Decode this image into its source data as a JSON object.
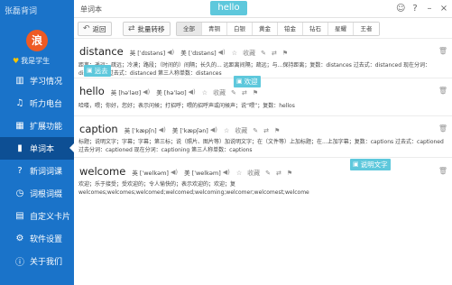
{
  "app": {
    "title": "张磊背词"
  },
  "sidebar": {
    "avatar_char": "浪",
    "level_label": "我是学生",
    "items": [
      {
        "label": "学习情况",
        "icon": "chart-icon"
      },
      {
        "label": "听力电台",
        "icon": "headphones-icon"
      },
      {
        "label": "扩展功能",
        "icon": "grid-icon"
      },
      {
        "label": "单词本",
        "icon": "book-icon"
      },
      {
        "label": "新词词课",
        "icon": "question-icon"
      },
      {
        "label": "词根词缀",
        "icon": "clock-icon"
      },
      {
        "label": "自定义卡片",
        "icon": "card-icon"
      },
      {
        "label": "软件设置",
        "icon": "settings-icon"
      },
      {
        "label": "关于我们",
        "icon": "info-icon"
      }
    ],
    "active_index": 3
  },
  "header": {
    "page_title": "单词本",
    "tooltip": "hello"
  },
  "toolbar": {
    "back_label": "返回",
    "batch_label": "批量转移",
    "tabs": [
      "全部",
      "青铜",
      "白银",
      "黄金",
      "铂金",
      "钻石",
      "星耀",
      "王者"
    ],
    "active_tab": 0
  },
  "words": [
    {
      "word": "distance",
      "uk": "英 [ˈdɪstəns]",
      "us": "美 [ˈdɪstəns]",
      "meaning": "距离；遥远；疏远；冷漠；路段；（时间的）间隔；长久的... 远距离间隔；疏远；与...保持距离；复数：distances 过去式：distanced 现在分词：distancing 过去式：distanced 第三人称单数：distances",
      "chip": "远去"
    },
    {
      "word": "hello",
      "uk": "英 [həˈləʊ]",
      "us": "美 [həˈləʊ]",
      "meaning": "哈喽，喂；你好，您好；表示问候；打招呼；喂的招呼声或问候声；说“喂”；复数：hellos",
      "chip": "欢迎"
    },
    {
      "word": "caption",
      "uk": "英 [ˈkæpʃn]",
      "us": "美 [ˈkæpʃən]",
      "meaning": "标题；说明文字；字幕；字幕；第三标；说（照片、图片等）加说明文字；在（文件等）上加标题；在...上加字幕；复数：captions 过去式：captioned 过去分词：captioned 现在分词：captioning 第三人称单数：captions",
      "chip": null
    },
    {
      "word": "welcome",
      "uk": "英 [ˈwelkəm]",
      "us": "美 [ˈwelkəm]",
      "meaning": "欢迎；乐于接受；受欢迎的；令人愉快的；表示欢迎的；欢迎；复 welcomes;welcomes;welcomed;welcomed;welcoming;welcomer;welcomest;welcome",
      "chip": "说明文字"
    }
  ],
  "labels": {
    "fav": "收藏"
  }
}
